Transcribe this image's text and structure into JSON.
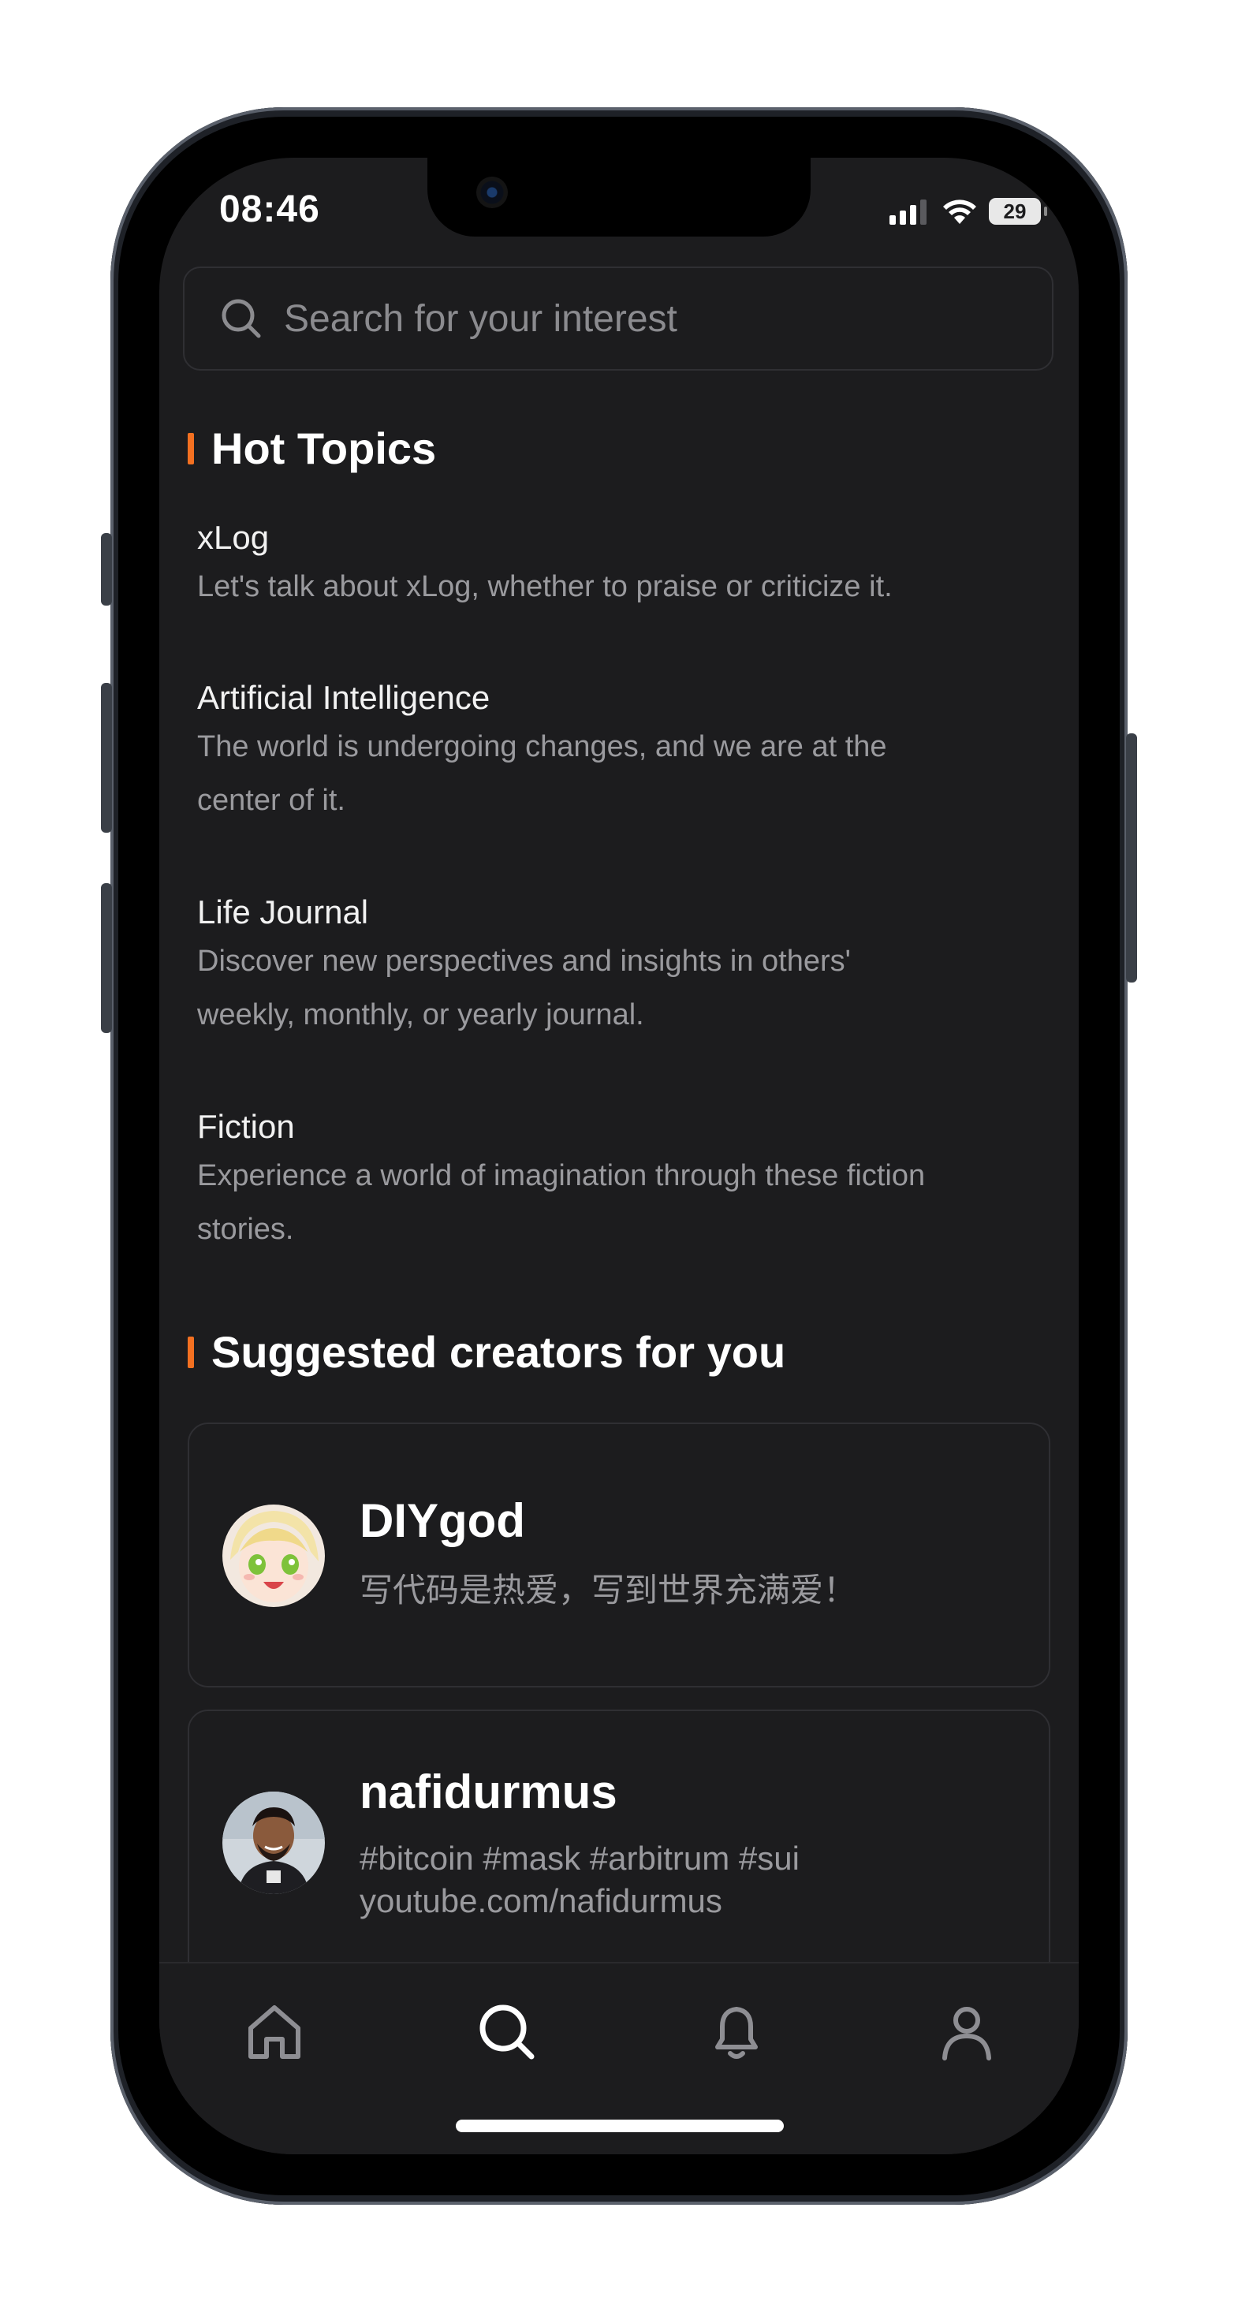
{
  "status_bar": {
    "time": "08:46",
    "battery": "29"
  },
  "search": {
    "placeholder": "Search for your interest"
  },
  "hot_topics": {
    "title": "Hot Topics",
    "items": [
      {
        "title": "xLog",
        "desc_lines": [
          "Let's talk about xLog, whether to praise or criticize it."
        ]
      },
      {
        "title": "Artificial Intelligence",
        "desc_lines": [
          "The world is undergoing changes, and we are at the",
          "center of it."
        ]
      },
      {
        "title": "Life Journal",
        "desc_lines": [
          "Discover new perspectives and insights in others'",
          "weekly, monthly, or yearly journal."
        ]
      },
      {
        "title": "Fiction",
        "desc_lines": [
          "Experience a world of imagination through these fiction",
          "stories."
        ]
      }
    ]
  },
  "creators": {
    "title": "Suggested creators for you",
    "items": [
      {
        "name": "DIYgod",
        "bio_lines": [
          "写代码是热爱，写到世界充满爱！"
        ]
      },
      {
        "name": "nafidurmus",
        "bio_lines": [
          "#bitcoin #mask #arbitrum #sui",
          "youtube.com/nafidurmus"
        ]
      }
    ]
  },
  "tabbar": {
    "tabs": [
      "home-icon",
      "search-icon",
      "bell-icon",
      "profile-icon"
    ],
    "active": "search-icon"
  },
  "colors": {
    "accent": "#f37021",
    "background": "#1c1c1e",
    "muted_text": "#9a9a9e"
  }
}
